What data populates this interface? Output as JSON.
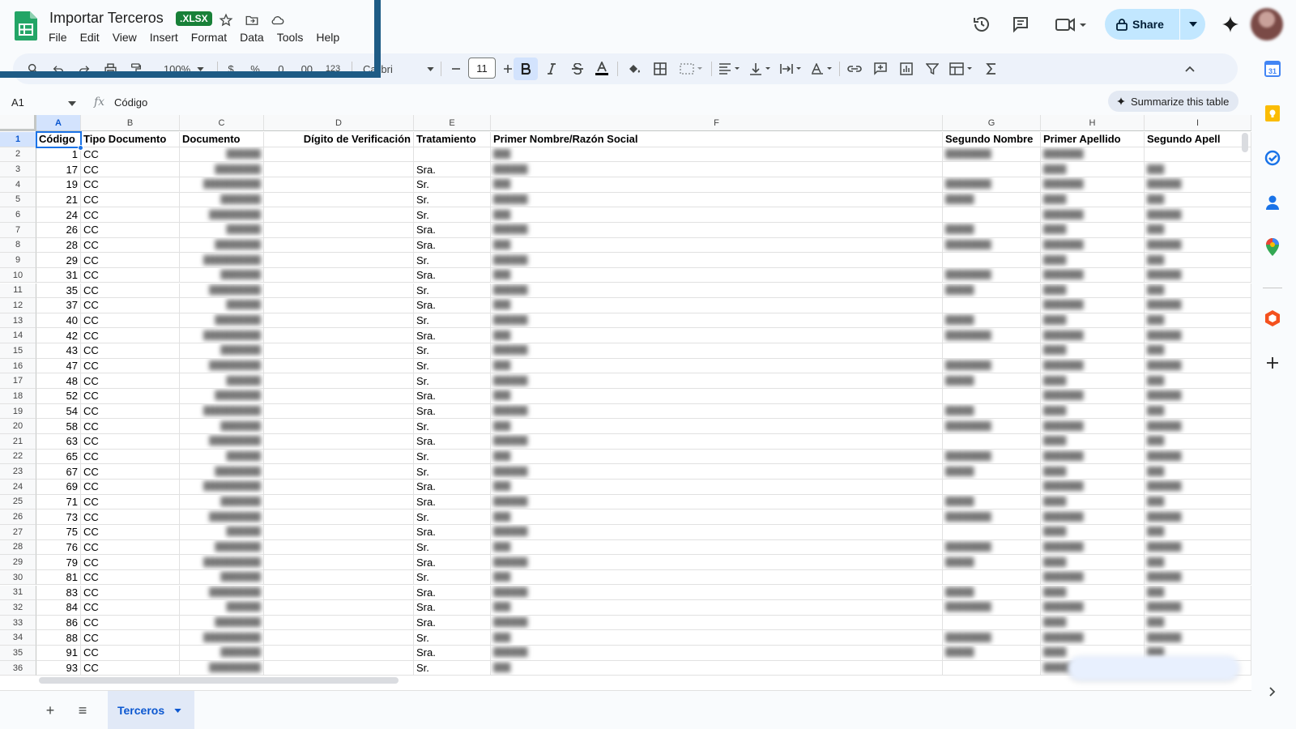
{
  "title": {
    "doc_name": "Importar Terceros",
    "badge": ".XLSX"
  },
  "menu": [
    "File",
    "Edit",
    "View",
    "Insert",
    "Format",
    "Data",
    "Tools",
    "Help"
  ],
  "toolbar": {
    "zoom": "100%",
    "currency": "$",
    "percent": "%",
    "dec_decrease": ".0",
    "dec_increase": ".00",
    "num_format": "123",
    "font": "Calibri",
    "font_size": "11"
  },
  "share": {
    "label": "Share"
  },
  "formula_bar": {
    "name_box": "A1",
    "fx": "fx",
    "value": "Código",
    "summarize": "Summarize this table"
  },
  "columns": [
    "A",
    "B",
    "C",
    "D",
    "E",
    "F",
    "G",
    "H",
    "I"
  ],
  "headers": [
    "Código",
    "Tipo Documento",
    "Documento",
    "Dígito de Verificación",
    "Tratamiento",
    "Primer Nombre/Razón Social",
    "Segundo Nombre",
    "Primer Apellido",
    "Segundo Apell"
  ],
  "rows": [
    {
      "n": "2",
      "codigo": "1",
      "tipo": "CC",
      "trat": ""
    },
    {
      "n": "3",
      "codigo": "17",
      "tipo": "CC",
      "trat": "Sra."
    },
    {
      "n": "4",
      "codigo": "19",
      "tipo": "CC",
      "trat": "Sr."
    },
    {
      "n": "5",
      "codigo": "21",
      "tipo": "CC",
      "trat": "Sr."
    },
    {
      "n": "6",
      "codigo": "24",
      "tipo": "CC",
      "trat": "Sr."
    },
    {
      "n": "7",
      "codigo": "26",
      "tipo": "CC",
      "trat": "Sra."
    },
    {
      "n": "8",
      "codigo": "28",
      "tipo": "CC",
      "trat": "Sra."
    },
    {
      "n": "9",
      "codigo": "29",
      "tipo": "CC",
      "trat": "Sr."
    },
    {
      "n": "10",
      "codigo": "31",
      "tipo": "CC",
      "trat": "Sra."
    },
    {
      "n": "11",
      "codigo": "35",
      "tipo": "CC",
      "trat": "Sr."
    },
    {
      "n": "12",
      "codigo": "37",
      "tipo": "CC",
      "trat": "Sra."
    },
    {
      "n": "13",
      "codigo": "40",
      "tipo": "CC",
      "trat": "Sr."
    },
    {
      "n": "14",
      "codigo": "42",
      "tipo": "CC",
      "trat": "Sra."
    },
    {
      "n": "15",
      "codigo": "43",
      "tipo": "CC",
      "trat": "Sr."
    },
    {
      "n": "16",
      "codigo": "47",
      "tipo": "CC",
      "trat": "Sr."
    },
    {
      "n": "17",
      "codigo": "48",
      "tipo": "CC",
      "trat": "Sr."
    },
    {
      "n": "18",
      "codigo": "52",
      "tipo": "CC",
      "trat": "Sra."
    },
    {
      "n": "19",
      "codigo": "54",
      "tipo": "CC",
      "trat": "Sra."
    },
    {
      "n": "20",
      "codigo": "58",
      "tipo": "CC",
      "trat": "Sr."
    },
    {
      "n": "21",
      "codigo": "63",
      "tipo": "CC",
      "trat": "Sra."
    },
    {
      "n": "22",
      "codigo": "65",
      "tipo": "CC",
      "trat": "Sr."
    },
    {
      "n": "23",
      "codigo": "67",
      "tipo": "CC",
      "trat": "Sr."
    },
    {
      "n": "24",
      "codigo": "69",
      "tipo": "CC",
      "trat": "Sra."
    },
    {
      "n": "25",
      "codigo": "71",
      "tipo": "CC",
      "trat": "Sra."
    },
    {
      "n": "26",
      "codigo": "73",
      "tipo": "CC",
      "trat": "Sr."
    },
    {
      "n": "27",
      "codigo": "75",
      "tipo": "CC",
      "trat": "Sra."
    },
    {
      "n": "28",
      "codigo": "76",
      "tipo": "CC",
      "trat": "Sr."
    },
    {
      "n": "29",
      "codigo": "79",
      "tipo": "CC",
      "trat": "Sra."
    },
    {
      "n": "30",
      "codigo": "81",
      "tipo": "CC",
      "trat": "Sr."
    },
    {
      "n": "31",
      "codigo": "83",
      "tipo": "CC",
      "trat": "Sra."
    },
    {
      "n": "32",
      "codigo": "84",
      "tipo": "CC",
      "trat": "Sra."
    },
    {
      "n": "33",
      "codigo": "86",
      "tipo": "CC",
      "trat": "Sra."
    },
    {
      "n": "34",
      "codigo": "88",
      "tipo": "CC",
      "trat": "Sr."
    },
    {
      "n": "35",
      "codigo": "91",
      "tipo": "CC",
      "trat": "Sra."
    },
    {
      "n": "36",
      "codigo": "93",
      "tipo": "CC",
      "trat": "Sr."
    }
  ],
  "sheets": {
    "add_label": "+",
    "list_label": "≡",
    "active": "Terceros"
  },
  "side_icons": [
    "calendar-icon",
    "keep-icon",
    "tasks-icon",
    "contacts-icon",
    "maps-icon",
    "addon-icon",
    "add-icon"
  ],
  "colors": {
    "brand_green": "#188038",
    "accent_blue": "#1a73e8",
    "share_bg": "#c2e7ff",
    "selection_bg": "#d3e3fd",
    "overlay": "#1e5b85"
  }
}
